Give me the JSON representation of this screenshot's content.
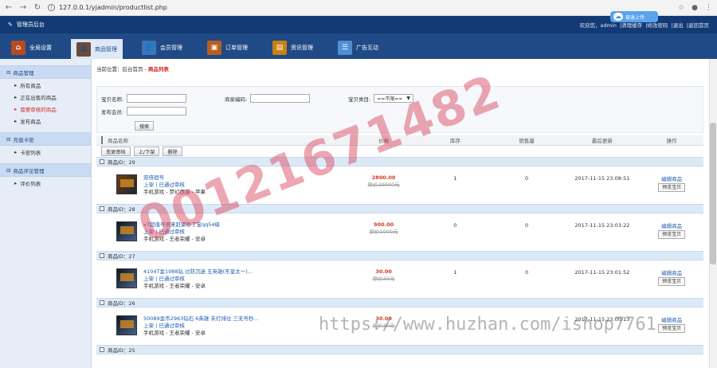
{
  "browser": {
    "url": "127.0.0.1/yjadmin/productlist.php",
    "icons": [
      "back-icon",
      "forward-icon",
      "reload-icon",
      "star-icon",
      "profile-icon",
      "menu-icon"
    ]
  },
  "topbar": {
    "title": "管理员后台",
    "user_text": "欢迎您，admin",
    "links": [
      "|清理缓存",
      "|修改密码",
      "|退出",
      "|返回首页"
    ],
    "cloud_label": "极速上传"
  },
  "mainnav": [
    {
      "label": "全局设置",
      "icon": "home-icon",
      "color": "#b54b20"
    },
    {
      "label": "商品管理",
      "icon": "goods-icon",
      "color": "#6b4b39",
      "active": true
    },
    {
      "label": "会员管理",
      "icon": "member-icon",
      "color": "#3a75b7"
    },
    {
      "label": "订单管理",
      "icon": "order-icon",
      "color": "#b85f1d"
    },
    {
      "label": "资讯管理",
      "icon": "news-icon",
      "color": "#c78115"
    },
    {
      "label": "广告互动",
      "icon": "ad-icon",
      "color": "#4e8ed4"
    }
  ],
  "sidebar": {
    "sections": [
      {
        "title": "商品管理",
        "items": [
          "所有商品",
          "正在出售的商品",
          "需要审核的商品",
          "发布商品"
        ]
      },
      {
        "title": "充值卡密",
        "items": [
          "卡密列表"
        ]
      },
      {
        "title": "商品评论管理",
        "items": [
          "评价列表"
        ]
      }
    ]
  },
  "breadcrumb": {
    "prefix": "当前位置：后台首页 -",
    "current": "商品列表"
  },
  "filters": {
    "labels": [
      "宝贝名称:",
      "商家编码:",
      "宝贝类目:",
      "发布会员:"
    ],
    "category": "==不限==",
    "search": "搜索"
  },
  "table": {
    "headers": [
      "商品名称",
      "价格",
      "库存",
      "销售量",
      "最后更新",
      "操作"
    ],
    "actions": [
      "变更审核",
      "上/下架",
      "删除"
    ],
    "rows": [
      {
        "id": "商品ID：29",
        "name": "双倍宿号",
        "state": "上架 | 已通过审核",
        "category": "手机游戏 - 梦幻西游 - 苹果",
        "price": "2800.00",
        "old_price": "原价29990元",
        "stock": "1",
        "sold": "0",
        "updated": "2017-11-15 23:08:51",
        "edit": "编辑商品",
        "preview": "预览宝贝"
      },
      {
        "id": "商品ID：28",
        "name": "v7超值号很来赶紧秒了宝qq54级",
        "state": "上架 | 已通过审核",
        "category": "手机游戏 - 王者荣耀 - 安卓",
        "price": "900.00",
        "old_price": "原价1000元",
        "stock": "0",
        "sold": "0",
        "updated": "2017-11-15 23:03:22",
        "edit": "编辑商品",
        "preview": "预览宝贝"
      },
      {
        "id": "商品ID：27",
        "name": "4104T金1988钻 过防沉迷 五英雄(东皇太一)...",
        "state": "上架 | 已通过审核",
        "category": "手机游戏 - 王者荣耀 - 安卓",
        "price": "30.00",
        "old_price": "原价30元",
        "stock": "1",
        "sold": "0",
        "updated": "2017-11-15 23:01:52",
        "edit": "编辑商品",
        "preview": "预览宝贝"
      },
      {
        "id": "商品ID：26",
        "name": "50089金币2963钻石 6英雄 未打排位 三无号秒...",
        "state": "上架 | 已通过审核",
        "category": "手机游戏 - 王者荣耀 - 安卓",
        "price": "30.00",
        "old_price": "原价30元",
        "stock": "",
        "sold": "",
        "updated": "2017-11-15 23:00:13",
        "edit": "编辑商品",
        "preview": "预览宝贝"
      },
      {
        "id": "商品ID：25"
      }
    ]
  },
  "watermark": {
    "text": "00121671482",
    "url": "https://www.huzhan.com/ishop7761"
  }
}
